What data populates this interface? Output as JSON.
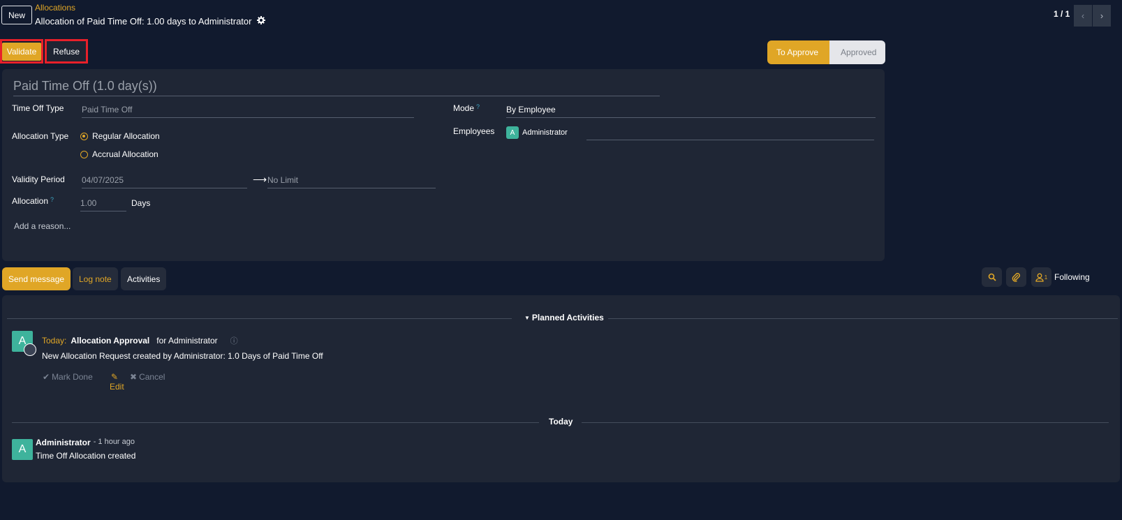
{
  "breadcrumb": {
    "new_label": "New",
    "parent": "Allocations",
    "title": "Allocation of Paid Time Off: 1.00 days to Administrator"
  },
  "pager": {
    "value": "1 / 1"
  },
  "actions": {
    "validate": "Validate",
    "refuse": "Refuse"
  },
  "statusbar": {
    "to_approve": "To Approve",
    "approved": "Approved"
  },
  "form": {
    "name": "Paid Time Off (1.0 day(s))",
    "time_off_type_label": "Time Off Type",
    "time_off_type_value": "Paid Time Off",
    "allocation_type_label": "Allocation Type",
    "regular_allocation": "Regular Allocation",
    "accrual_allocation": "Accrual Allocation",
    "validity_label": "Validity Period",
    "validity_start": "04/07/2025",
    "validity_end": "No Limit",
    "allocation_label": "Allocation",
    "allocation_help": "?",
    "allocation_value": "1.00",
    "allocation_unit": "Days",
    "reason_placeholder": "Add a reason...",
    "mode_label": "Mode",
    "mode_help": "?",
    "mode_value": "By Employee",
    "employees_label": "Employees",
    "employee_initial": "A",
    "employee_name": "Administrator"
  },
  "chatter": {
    "send_message": "Send message",
    "log_note": "Log note",
    "activities": "Activities",
    "followers_count": "1",
    "following": "Following",
    "planned_header": "Planned Activities",
    "activity": {
      "avatar": "A",
      "when": "Today:",
      "summary": "Allocation Approval",
      "for": "for Administrator",
      "note": "New Allocation Request created by Administrator: 1.0 Days of Paid Time Off",
      "mark_done": "Mark Done",
      "edit": "Edit",
      "cancel": "Cancel"
    },
    "today_header": "Today",
    "message": {
      "avatar": "A",
      "author": "Administrator",
      "time": "- 1 hour ago",
      "body": "Time Off Allocation created"
    }
  },
  "colors": {
    "accent": "#e0a626",
    "background": "#111a2e",
    "panel": "#1f2635",
    "teal": "#3eb39c",
    "highlight": "#e8202a"
  }
}
